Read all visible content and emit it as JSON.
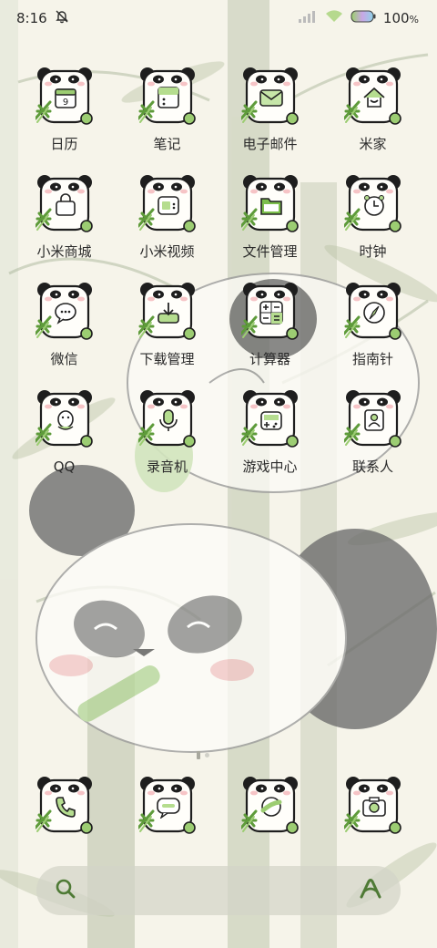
{
  "status": {
    "time": "8:16",
    "battery": "100",
    "battery_unit": "%",
    "icons": [
      "bell-off-icon",
      "signal-icon",
      "wifi-icon",
      "battery-icon"
    ]
  },
  "apps": [
    {
      "label": "日历",
      "icon": "calendar-icon",
      "day": "9"
    },
    {
      "label": "笔记",
      "icon": "notes-icon"
    },
    {
      "label": "电子邮件",
      "icon": "mail-icon"
    },
    {
      "label": "米家",
      "icon": "home-icon"
    },
    {
      "label": "小米商城",
      "icon": "shopping-bag-icon"
    },
    {
      "label": "小米视频",
      "icon": "video-icon"
    },
    {
      "label": "文件管理",
      "icon": "folder-icon"
    },
    {
      "label": "时钟",
      "icon": "clock-icon"
    },
    {
      "label": "微信",
      "icon": "wechat-icon"
    },
    {
      "label": "下载管理",
      "icon": "download-icon"
    },
    {
      "label": "计算器",
      "icon": "calculator-icon"
    },
    {
      "label": "指南针",
      "icon": "compass-icon"
    },
    {
      "label": "QQ",
      "icon": "qq-icon"
    },
    {
      "label": "录音机",
      "icon": "recorder-icon"
    },
    {
      "label": "游戏中心",
      "icon": "gamepad-icon"
    },
    {
      "label": "联系人",
      "icon": "contacts-icon"
    }
  ],
  "dock": [
    {
      "icon": "phone-icon"
    },
    {
      "icon": "message-icon"
    },
    {
      "icon": "browser-icon"
    },
    {
      "icon": "camera-icon"
    }
  ],
  "search": {
    "left_icon": "search-icon",
    "right_icon": "assistant-icon"
  },
  "page_indicator": {
    "pages": 2,
    "current": 1
  },
  "colors": {
    "accent": "#8fc46a",
    "accent_dark": "#4e7a35",
    "panda": "#1e1e1e",
    "background": "#f6f4ea"
  }
}
